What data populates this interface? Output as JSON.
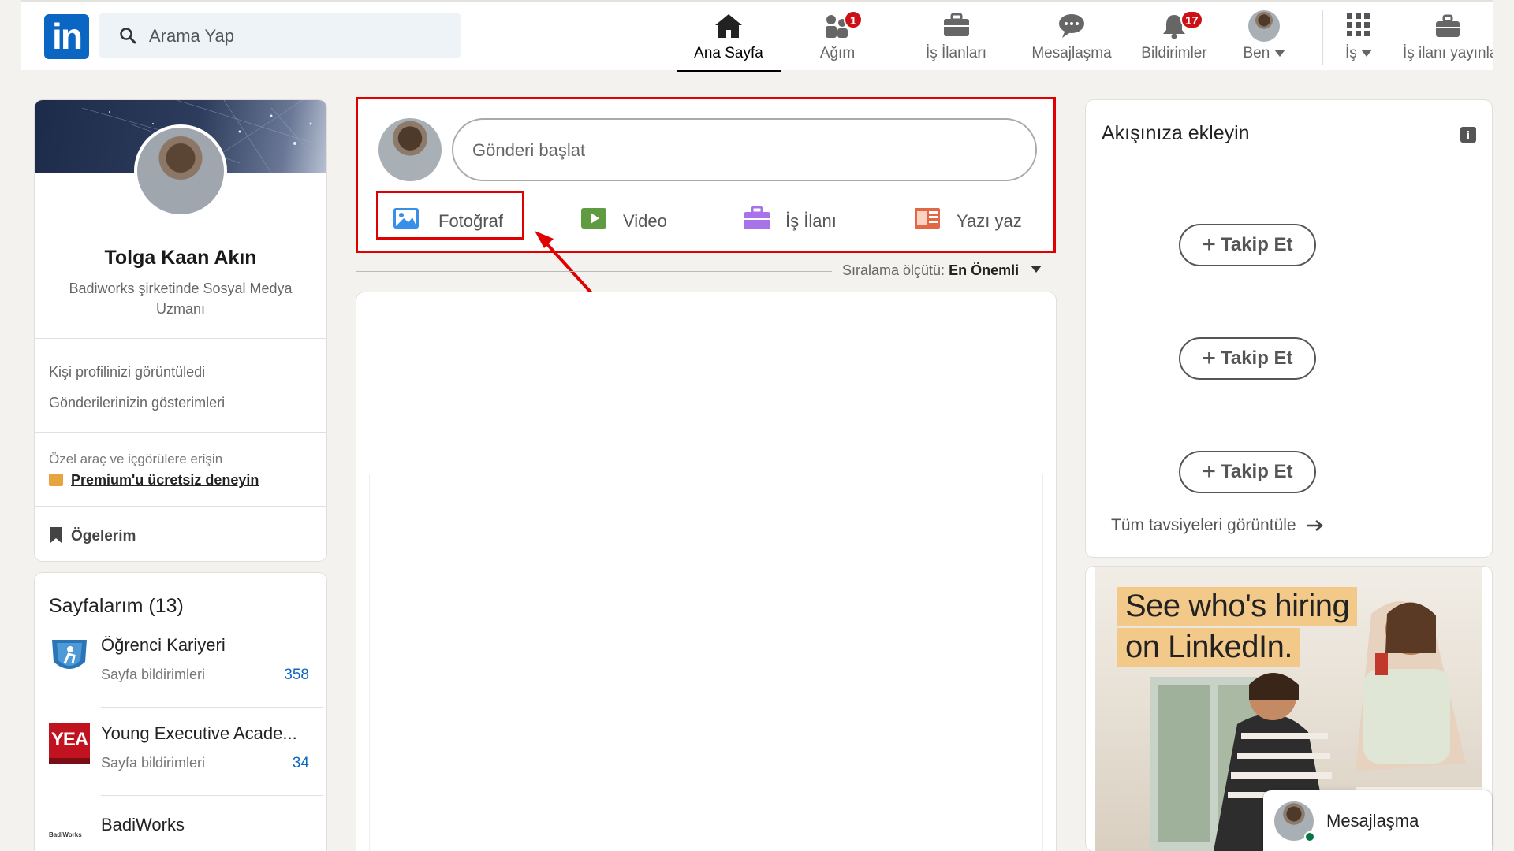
{
  "nav": {
    "search_placeholder": "Arama Yap",
    "items": [
      {
        "label": "Ana Sayfa",
        "icon": "home-icon",
        "active": true
      },
      {
        "label": "Ağım",
        "icon": "network-icon",
        "badge": "1"
      },
      {
        "label": "İş İlanları",
        "icon": "briefcase-icon"
      },
      {
        "label": "Mesajlaşma",
        "icon": "message-icon"
      },
      {
        "label": "Bildirimler",
        "icon": "bell-icon",
        "badge": "17"
      },
      {
        "label": "Ben",
        "icon": "avatar-icon"
      },
      {
        "label": "İş",
        "icon": "grid-icon"
      },
      {
        "label": "İş ilanı yayınla",
        "icon": "post-job-icon"
      }
    ]
  },
  "profile": {
    "name": "Tolga Kaan Akın",
    "headline": "Badiworks şirketinde Sosyal Medya Uzmanı",
    "stats": [
      "Kişi profilinizi görüntüledi",
      "Gönderilerinizin gösterimleri"
    ],
    "premium_text": "Özel araç ve içgörülere erişin",
    "premium_link": "Premium'u ücretsiz deneyin",
    "my_items": "Ögelerim"
  },
  "pages": {
    "title": "Sayfalarım (13)",
    "items": [
      {
        "name": "Öğrenci Kariyeri",
        "sub": "Sayfa bildirimleri",
        "count": "358"
      },
      {
        "name": "Young Executive Acade...",
        "sub": "Sayfa bildirimleri",
        "count": "34",
        "logo_text": "YEA"
      },
      {
        "name": "BadiWorks",
        "logo_text": "BadiWorks"
      }
    ]
  },
  "share": {
    "placeholder": "Gönderi başlat",
    "actions": [
      {
        "label": "Fotoğraf",
        "icon": "photo-icon",
        "color": "#378fe9"
      },
      {
        "label": "Video",
        "icon": "video-icon",
        "color": "#5f9b41"
      },
      {
        "label": "İş İlanı",
        "icon": "job-icon",
        "color": "#a872e8"
      },
      {
        "label": "Yazı yaz",
        "icon": "article-icon",
        "color": "#e16745"
      }
    ],
    "sort_label": "Sıralama ölçütü:",
    "sort_value": "En Önemli"
  },
  "rail": {
    "title": "Akışınıza ekleyin",
    "follow_label": "Takip Et",
    "view_all": "Tüm tavsiyeleri görüntüle"
  },
  "ad": {
    "line1": "See who's hiring",
    "line2": "on LinkedIn."
  },
  "messaging": {
    "label": "Mesajlaşma"
  },
  "colors": {
    "brand": "#0a66c2",
    "highlight": "#e00000",
    "badge": "#cc1016"
  }
}
